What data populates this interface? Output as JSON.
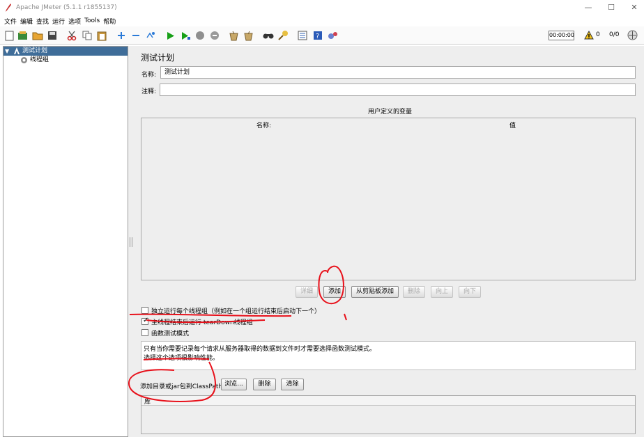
{
  "window": {
    "title": "Apache JMeter (5.1.1 r1855137)"
  },
  "menubar": [
    "文件",
    "编辑",
    "查找",
    "运行",
    "选项",
    "Tools",
    "帮助"
  ],
  "toolbar": {
    "icons": [
      "new-icon",
      "templates-icon",
      "open-icon",
      "save-icon",
      "cut-icon",
      "copy-icon",
      "paste-icon",
      "expand-icon",
      "collapse-icon",
      "toggle-icon",
      "start-icon",
      "start-no-pause-icon",
      "stop-icon",
      "shutdown-icon",
      "clear-icon",
      "clear-all-icon",
      "search-icon",
      "reset-search-icon",
      "function-helper-icon",
      "help-icon",
      "remote-icon"
    ],
    "timer": "00:00:00",
    "warning_count": "0",
    "thread_count": "0/0"
  },
  "tree": {
    "items": [
      {
        "label": "测试计划",
        "selected": true,
        "expanded": true
      },
      {
        "label": "线程组",
        "selected": false
      }
    ]
  },
  "panel": {
    "title": "测试计划",
    "name_label": "名称:",
    "name_value": "测试计划",
    "comment_label": "注释:",
    "comment_value": "",
    "vars_title": "用户定义的变量",
    "vars_columns": [
      "名称:",
      "值"
    ],
    "vars_buttons": {
      "detail": "详细",
      "add": "添加",
      "add_clipboard": "从剪贴板添加",
      "delete": "删除",
      "up": "向上",
      "down": "向下"
    },
    "options": [
      {
        "label": "独立运行每个线程组（例如在一个组运行结束后启动下一个）",
        "checked": false
      },
      {
        "label": "主线程结束后运行 tearDown线程组",
        "checked": true
      },
      {
        "label": "函数测试模式",
        "checked": false
      }
    ],
    "note_lines": [
      "只有当你需要记录每个请求从服务器取得的数据到文件时才需要选择函数测试模式。",
      "选择这个选项很影响性能。"
    ],
    "classpath_label": "添加目录或jar包到ClassPath",
    "classpath_buttons": {
      "browse": "浏览...",
      "delete": "删除",
      "clear": "清除"
    },
    "lib_header": "库"
  },
  "colors": {
    "selection": "#3f6d99",
    "panel_bg": "#eeeeee",
    "annotation": "#e8101a"
  }
}
